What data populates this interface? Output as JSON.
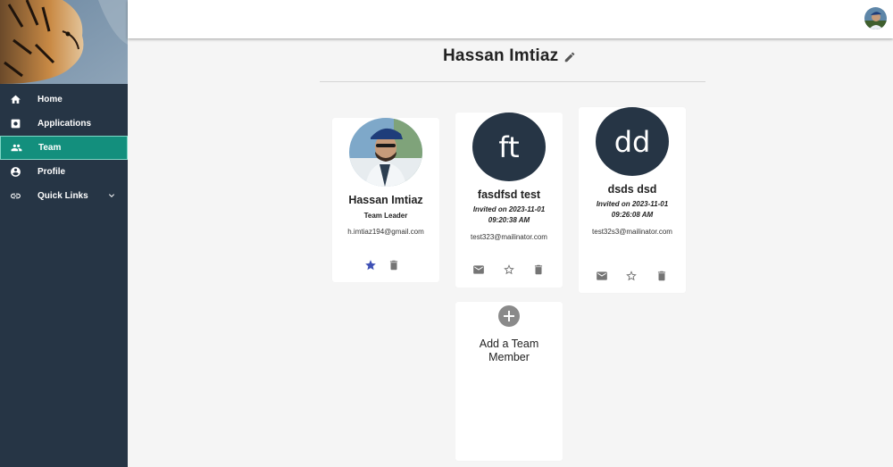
{
  "sidebar": {
    "items": [
      {
        "label": "Home",
        "icon": "home-icon"
      },
      {
        "label": "Applications",
        "icon": "applications-icon"
      },
      {
        "label": "Team",
        "icon": "team-icon",
        "active": true
      },
      {
        "label": "Profile",
        "icon": "profile-icon"
      },
      {
        "label": "Quick Links",
        "icon": "link-icon",
        "expandable": true
      }
    ]
  },
  "page": {
    "title": "Hassan Imtiaz"
  },
  "members": [
    {
      "name": "Hassan Imtiaz",
      "role": "Team Leader",
      "email": "h.imtiaz194@gmail.com",
      "avatar": "photo",
      "starred": true
    },
    {
      "name": "fasdfsd test",
      "initials": "ft",
      "invited_line1": "Invited on 2023-11-01",
      "invited_line2": "09:20:38 AM",
      "email": "test323@mailinator.com"
    },
    {
      "name": "dsds dsd",
      "initials": "dd",
      "invited_line1": "Invited on 2023-11-01",
      "invited_line2": "09:26:08 AM",
      "email": "test32s3@mailinator.com"
    }
  ],
  "add_member": {
    "label": "Add a Team Member"
  },
  "colors": {
    "sidebar_bg": "#263545",
    "active_item": "#138f7d",
    "avatar_bg": "#263545",
    "star_active": "#3f51b5",
    "icon_gray": "#757575"
  }
}
